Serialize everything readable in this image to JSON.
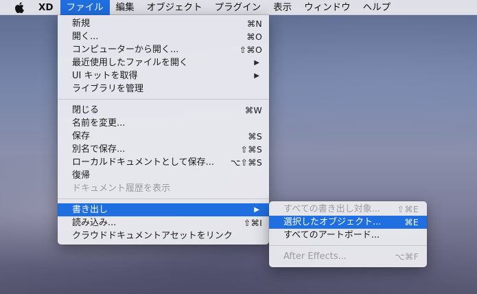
{
  "menubar": {
    "apple_icon": "apple-icon",
    "items": [
      "XD",
      "ファイル",
      "編集",
      "オブジェクト",
      "プラグイン",
      "表示",
      "ウィンドウ",
      "ヘルプ"
    ]
  },
  "file_menu": {
    "groups": [
      [
        {
          "label": "新規",
          "shortcut": "⌘N"
        },
        {
          "label": "開く...",
          "shortcut": "⌘O"
        },
        {
          "label": "コンピューターから開く...",
          "shortcut": "⇧⌘O"
        },
        {
          "label": "最近使用したファイルを開く",
          "submenu": true
        },
        {
          "label": "UI キットを取得",
          "submenu": true
        },
        {
          "label": "ライブラリを管理"
        }
      ],
      [
        {
          "label": "閉じる",
          "shortcut": "⌘W"
        },
        {
          "label": "名前を変更..."
        },
        {
          "label": "保存",
          "shortcut": "⌘S"
        },
        {
          "label": "別名で保存...",
          "shortcut": "⇧⌘S"
        },
        {
          "label": "ローカルドキュメントとして保存...",
          "shortcut": "⌥⇧⌘S"
        },
        {
          "label": "復帰"
        },
        {
          "label": "ドキュメント履歴を表示",
          "disabled": true
        }
      ],
      [
        {
          "label": "書き出し",
          "submenu": true,
          "highlighted": true
        },
        {
          "label": "読み込み...",
          "shortcut": "⇧⌘I"
        },
        {
          "label": "クラウドドキュメントアセットをリンク"
        }
      ]
    ]
  },
  "export_menu": {
    "groups": [
      [
        {
          "label": "すべての書き出し対象...",
          "shortcut": "⇧⌘E",
          "disabled": true
        },
        {
          "label": "選択したオブジェクト...",
          "shortcut": "⌘E",
          "highlighted": true
        },
        {
          "label": "すべてのアートボード..."
        }
      ],
      [
        {
          "label": "After Effects...",
          "shortcut": "⌥⌘F",
          "disabled": true
        }
      ]
    ]
  },
  "colors": {
    "highlight": "#1f6fe0",
    "menu_bg": "#ebebf0",
    "disabled_text": "#9a9aa0"
  }
}
